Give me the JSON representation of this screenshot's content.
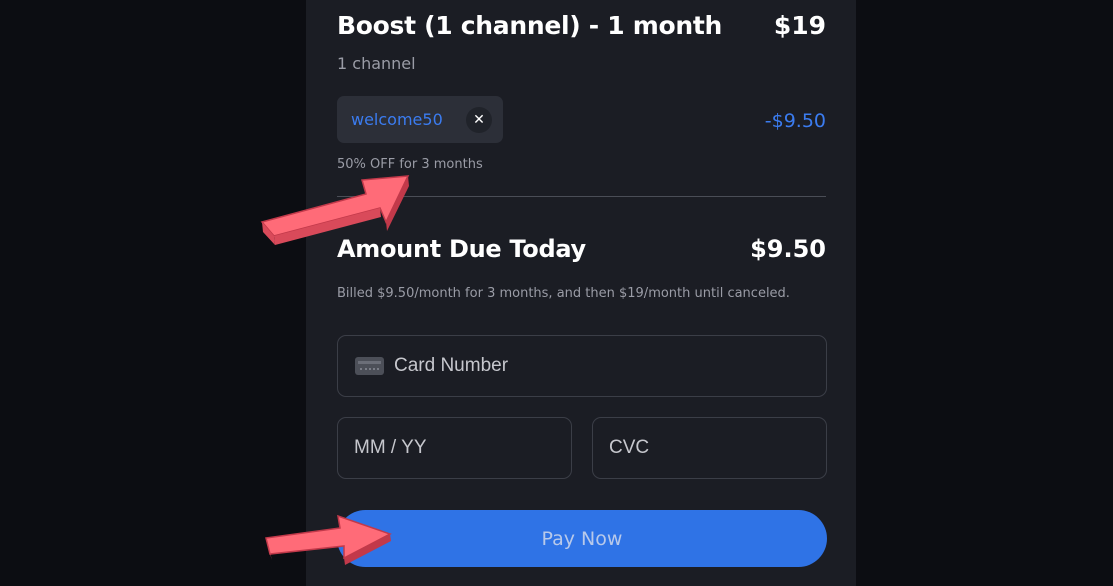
{
  "plan": {
    "title": "Boost (1 channel) - 1 month",
    "price": "$19",
    "subtitle": "1 channel"
  },
  "coupon": {
    "code": "welcome50",
    "remove_icon": "close-icon",
    "discount": "-$9.50",
    "note": "50% OFF for 3 months"
  },
  "summary": {
    "due_label": "Amount Due Today",
    "due_amount": "$9.50",
    "billing_note": "Billed $9.50/month for 3 months, and then $19/month until canceled."
  },
  "form": {
    "card_placeholder": "Card Number",
    "card_icon": "credit-card-icon",
    "expiry_placeholder": "MM / YY",
    "cvc_placeholder": "CVC",
    "pay_label": "Pay Now"
  },
  "colors": {
    "accent": "#2f73e6",
    "discount": "#3b7cf0",
    "annotation_arrow": "#ff6b78"
  }
}
